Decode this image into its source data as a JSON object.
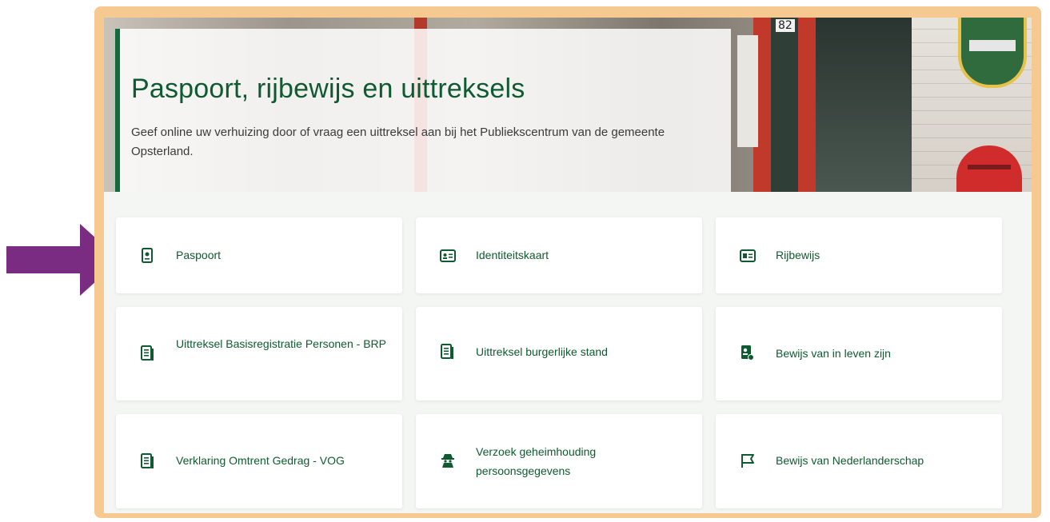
{
  "hero": {
    "title": "Paspoort, rijbewijs en uittreksels",
    "description": "Geef online uw verhuizing door of vraag een uittreksel aan bij het Publiekscentrum van de gemeente Opsterland.",
    "house_number": "82"
  },
  "colors": {
    "frame": "#f5c98f",
    "accent_green": "#0f5a30",
    "arrow_purple": "#7a2b82"
  },
  "tiles": [
    {
      "label": "Paspoort",
      "icon": "passport-icon"
    },
    {
      "label": "Identiteitskaart",
      "icon": "id-card-icon"
    },
    {
      "label": "Rijbewijs",
      "icon": "driver-license-icon"
    },
    {
      "label": "Uittreksel Basisregistratie Personen - BRP",
      "icon": "document-icon"
    },
    {
      "label": "Uittreksel burgerlijke stand",
      "icon": "document-icon"
    },
    {
      "label": "Bewijs van in leven zijn",
      "icon": "life-certificate-icon"
    },
    {
      "label": "Verklaring Omtrent Gedrag - VOG",
      "icon": "document-icon"
    },
    {
      "label": "Verzoek geheimhouding persoonsgegevens",
      "icon": "spy-icon"
    },
    {
      "label": "Bewijs van Nederlanderschap",
      "icon": "flag-icon"
    }
  ]
}
